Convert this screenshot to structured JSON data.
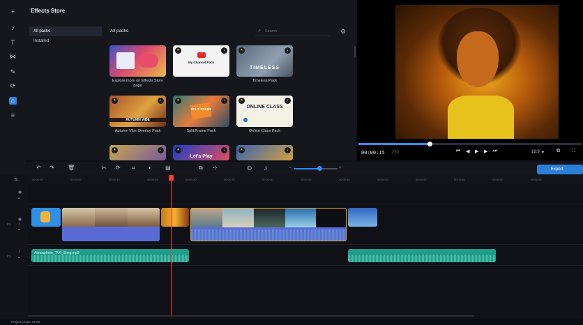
{
  "store": {
    "title": "Effects Store",
    "list": [
      "All packs",
      "Installed"
    ],
    "grid_title": "All packs",
    "search_placeholder": "Search",
    "cards": [
      {
        "label": "Explore more on Effects Store page",
        "overlay": ""
      },
      {
        "label": "",
        "overlay": "My Channel Pack"
      },
      {
        "label": "Timeless Pack",
        "overlay": "TIMELESS"
      },
      {
        "label": "Autumn Vibe Overlay Pack",
        "overlay": "AUTUMN VIBE"
      },
      {
        "label": "Split Frame Pack",
        "overlay": "SPLIT FRAME"
      },
      {
        "label": "Online Class Pack",
        "overlay": "ONLINE CLASS"
      },
      {
        "label": "",
        "overlay": ""
      },
      {
        "label": "",
        "overlay": "Let's Play"
      },
      {
        "label": "",
        "overlay": ""
      }
    ]
  },
  "player": {
    "timecode": "00:00:15",
    "timecode_frac": ".220",
    "aspect": "16:9",
    "progress": 0.32
  },
  "timeline": {
    "export_label": "Export",
    "ruler": [
      "00:00:00",
      "00:00:05",
      "00:00:10",
      "00:00:15",
      "00:00:20",
      "00:00:25",
      "00:00:30",
      "00:00:35",
      "00:00:40",
      "00:00:45",
      "00:00:50",
      "00:00:55",
      "00:01:00",
      "00:01:05"
    ],
    "audio_clip_label": "Atmosphere_TV6_Song.mp3",
    "zoom_level": 0.58
  },
  "status": {
    "text": "Project length: 01:50"
  }
}
